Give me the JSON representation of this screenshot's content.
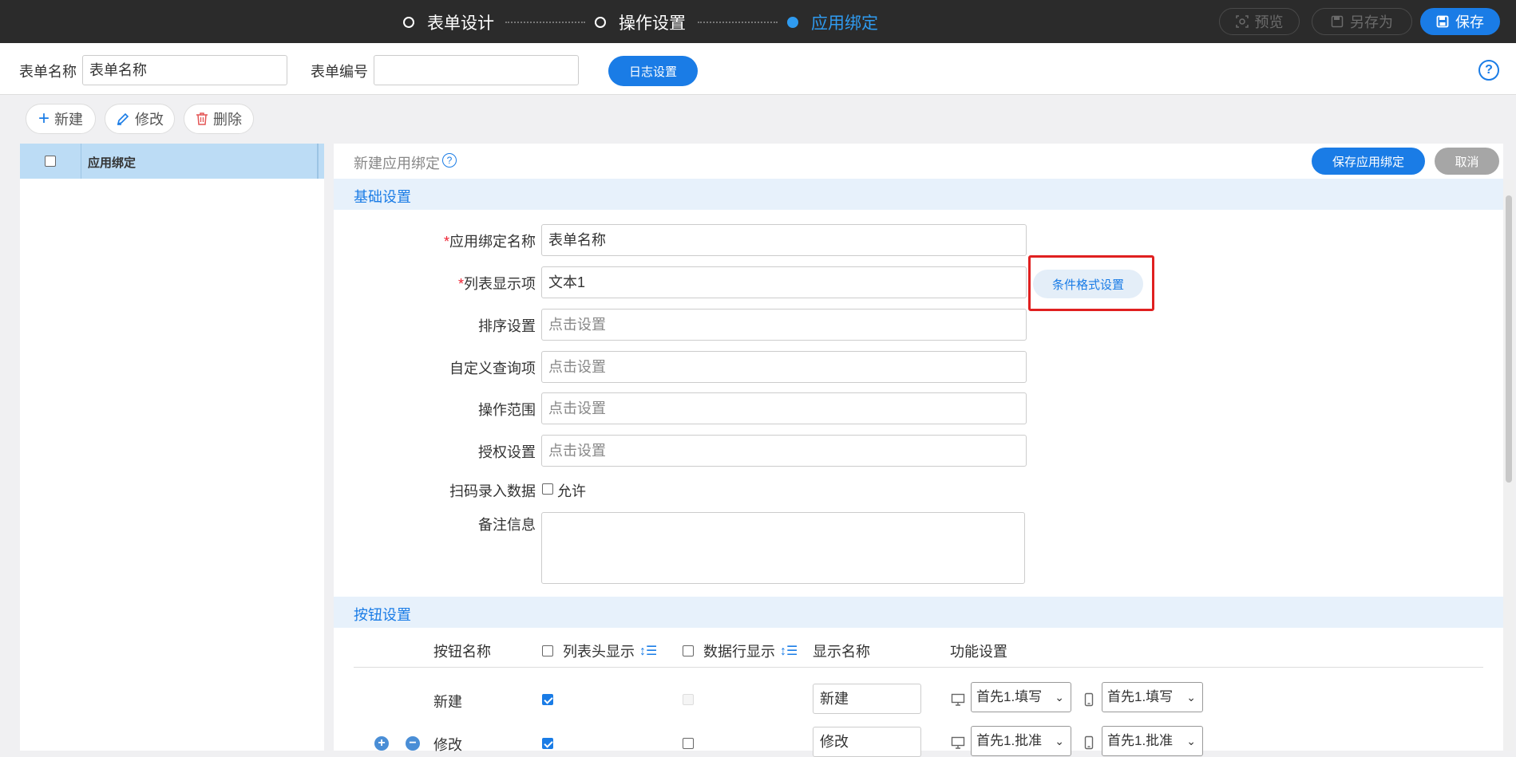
{
  "topbar": {
    "steps": [
      {
        "label": "表单设计",
        "active": false
      },
      {
        "label": "操作设置",
        "active": false
      },
      {
        "label": "应用绑定",
        "active": true
      }
    ],
    "preview_label": "预览",
    "save_as_label": "另存为",
    "save_label": "保存"
  },
  "form_header": {
    "name_label": "表单名称",
    "name_value": "表单名称",
    "code_label": "表单编号",
    "code_value": "",
    "log_button": "日志设置",
    "help": "?"
  },
  "toolbar": {
    "new_label": "新建",
    "edit_label": "修改",
    "delete_label": "删除"
  },
  "left_panel": {
    "column_header": "应用绑定"
  },
  "panel_header": {
    "title": "新建应用绑定",
    "help": "?",
    "save_binding": "保存应用绑定",
    "cancel": "取消"
  },
  "basic": {
    "section_title": "基础设置",
    "fields": [
      {
        "label": "应用绑定名称",
        "required": true,
        "value": "表单名称",
        "placeholder": ""
      },
      {
        "label": "列表显示项",
        "required": true,
        "value": "文本1",
        "placeholder": ""
      },
      {
        "label": "排序设置",
        "required": false,
        "value": "",
        "placeholder": "点击设置"
      },
      {
        "label": "自定义查询项",
        "required": false,
        "value": "",
        "placeholder": "点击设置"
      },
      {
        "label": "操作范围",
        "required": false,
        "value": "",
        "placeholder": "点击设置"
      },
      {
        "label": "授权设置",
        "required": false,
        "value": "",
        "placeholder": "点击设置"
      }
    ],
    "condition_format_button": "条件格式设置",
    "scan_label": "扫码录入数据",
    "scan_allow": "允许",
    "remark_label": "备注信息",
    "highlight_color": "#e02020"
  },
  "buttons": {
    "section_title": "按钮设置",
    "headers": {
      "name": "按钮名称",
      "list_header_show": "列表头显示",
      "row_show": "数据行显示",
      "display_name": "显示名称",
      "function": "功能设置"
    },
    "rows": [
      {
        "name": "新建",
        "list_header": true,
        "row_show": false,
        "row_disabled": true,
        "display": "新建",
        "pc_func": "首先1.填写",
        "mobile_func": "首先1.填写"
      },
      {
        "name": "修改",
        "list_header": true,
        "row_show": false,
        "row_disabled": false,
        "display": "修改",
        "pc_func": "首先1.批准",
        "mobile_func": "首先1.批准"
      }
    ]
  },
  "colors": {
    "accent": "#1a7ce6",
    "topbar": "#2b2b2b",
    "section_bg": "#e7f1fb",
    "selected_row": "#bcdcf5"
  }
}
